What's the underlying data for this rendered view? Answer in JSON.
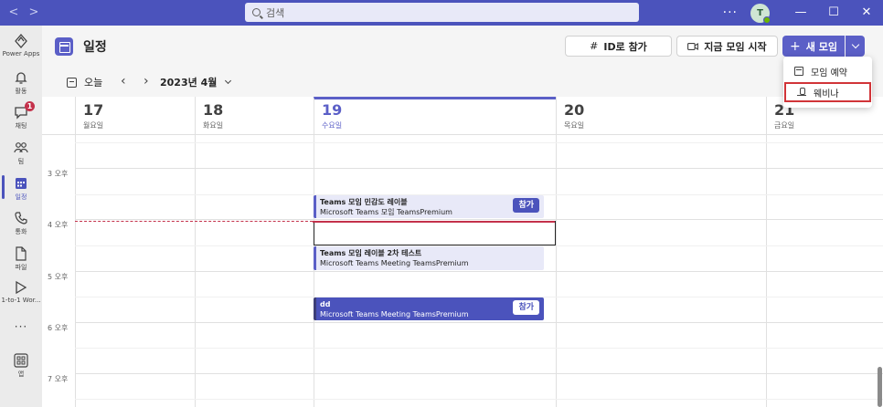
{
  "titlebar": {
    "search_placeholder": "검색",
    "more": "···",
    "avatar_initial": "T",
    "minimize": "—",
    "maximize": "☐",
    "close": "✕"
  },
  "rail": {
    "items": [
      {
        "label": "Power Apps",
        "icon": "power-apps-icon"
      },
      {
        "label": "활동",
        "icon": "bell-icon"
      },
      {
        "label": "채팅",
        "icon": "chat-icon",
        "badge": "1"
      },
      {
        "label": "팀",
        "icon": "teams-icon"
      },
      {
        "label": "일정",
        "icon": "calendar-icon",
        "active": true
      },
      {
        "label": "통화",
        "icon": "phone-icon"
      },
      {
        "label": "파일",
        "icon": "file-icon"
      },
      {
        "label": "1-to-1 Wor...",
        "icon": "play-icon"
      },
      {
        "label": "···",
        "icon": "more-icon"
      },
      {
        "label": "앱",
        "icon": "apps-icon"
      }
    ]
  },
  "header": {
    "title": "일정",
    "join_by_id": "ID로 참가",
    "meet_now": "지금 모임 시작",
    "new_meeting": "새 모임"
  },
  "toolbar": {
    "today": "오늘",
    "month": "2023년 4월"
  },
  "days": [
    {
      "num": "17",
      "name": "월요일"
    },
    {
      "num": "18",
      "name": "화요일"
    },
    {
      "num": "19",
      "name": "수요일",
      "today": true
    },
    {
      "num": "20",
      "name": "목요일"
    },
    {
      "num": "21",
      "name": "금요일"
    }
  ],
  "times": [
    "3 오후",
    "4 오후",
    "5 오후",
    "6 오후",
    "7 오후"
  ],
  "events": [
    {
      "title": "Teams 모임 민감도 레이블",
      "sub": "Microsoft Teams 모임  TeamsPremium",
      "join": "참가",
      "style": "light"
    },
    {
      "title": "Teams 모임 레이블 2차 테스트",
      "sub": "Microsoft Teams Meeting  TeamsPremium",
      "join": "",
      "style": "light"
    },
    {
      "title": "dd",
      "sub": "Microsoft Teams Meeting  TeamsPremium",
      "join": "참가",
      "style": "dark"
    }
  ],
  "dropdown": {
    "schedule": "모임 예약",
    "webinar": "웨비나"
  },
  "colors": {
    "brand": "#4b53bc",
    "accent": "#5b5fc7",
    "now_line": "#c4314b",
    "highlight_box": "#d13438"
  }
}
